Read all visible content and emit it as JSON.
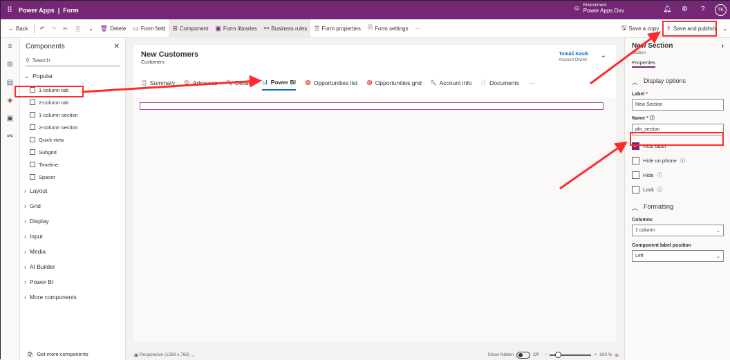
{
  "app": {
    "name": "Power Apps",
    "section": "Form",
    "environment_label": "Environment",
    "environment": "Power Apps Dev",
    "user_initials": "TK"
  },
  "toolbar": {
    "back": "Back",
    "delete": "Delete",
    "form_field": "Form field",
    "component": "Component",
    "form_libraries": "Form libraries",
    "business_rules": "Business rules",
    "form_properties": "Form properties",
    "form_settings": "Form settings",
    "more": "···",
    "save_copy": "Save a copy",
    "save_publish": "Save and publish"
  },
  "components": {
    "title": "Components",
    "search_placeholder": "Search",
    "popular": "Popular",
    "items": [
      "1-column tab",
      "2-column tab",
      "1-column section",
      "2-column section",
      "Quick view",
      "Subgrid",
      "Timeline",
      "Spacer"
    ],
    "categories": [
      "Layout",
      "Grid",
      "Display",
      "Input",
      "Media",
      "AI Builder",
      "Power BI",
      "More components"
    ],
    "get_more": "Get more components"
  },
  "form": {
    "title": "New Customers",
    "entity": "Customers",
    "owner_name": "Tomáš Kasík",
    "owner_role": "Account Owner",
    "tabs": [
      {
        "label": "Summary",
        "icon": "📋"
      },
      {
        "label": "Adresses",
        "icon": "🏠"
      },
      {
        "label": "Details",
        "icon": "🔍"
      },
      {
        "label": "Power BI",
        "icon": "📊",
        "active": true
      },
      {
        "label": "Opportunities list",
        "icon": "🎯"
      },
      {
        "label": "Opportunities grid",
        "icon": "🎯"
      },
      {
        "label": "Account info",
        "icon": "🔍"
      },
      {
        "label": "Documents",
        "icon": "📄"
      }
    ],
    "more": "···"
  },
  "status": {
    "layout": "Responsive (1269 x 783)",
    "show_hidden": "Show hidden",
    "toggle": "Off",
    "zoom": "100 %"
  },
  "props": {
    "title": "New Section",
    "subtitle": "Section",
    "tab": "Properties",
    "display_options": "Display options",
    "label_label": "Label",
    "label_value": "New Section",
    "name_label": "Name",
    "name_value": "pbi_section",
    "checks": [
      {
        "label": "Hide label",
        "checked": true
      },
      {
        "label": "Hide on phone",
        "checked": false
      },
      {
        "label": "Hide",
        "checked": false
      },
      {
        "label": "Lock",
        "checked": false
      }
    ],
    "formatting": "Formatting",
    "columns_label": "Columns",
    "columns_value": "1 column",
    "pos_label": "Component label position",
    "pos_value": "Left"
  },
  "colors": {
    "brand": "#742774",
    "accent": "#0f6cbd",
    "annotation": "#ff2a2a"
  }
}
